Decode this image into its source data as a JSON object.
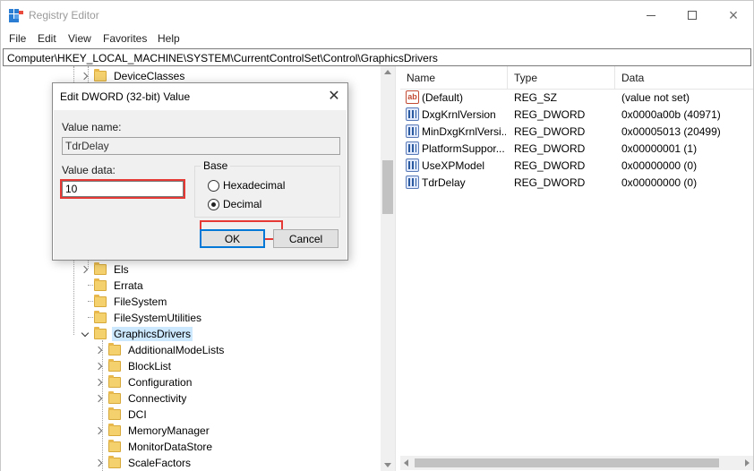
{
  "window": {
    "title": "Registry Editor",
    "controls": {
      "minimize": "minimize",
      "maximize": "maximize",
      "close": "×"
    }
  },
  "menubar": [
    "File",
    "Edit",
    "View",
    "Favorites",
    "Help"
  ],
  "address": "Computer\\HKEY_LOCAL_MACHINE\\SYSTEM\\CurrentControlSet\\Control\\GraphicsDrivers",
  "tree": {
    "top_item": "DeviceClasses",
    "items": [
      "Els",
      "Errata",
      "FileSystem",
      "FileSystemUtilities",
      "GraphicsDrivers"
    ],
    "children": [
      "AdditionalModeLists",
      "BlockList",
      "Configuration",
      "Connectivity",
      "DCI",
      "MemoryManager",
      "MonitorDataStore",
      "ScaleFactors"
    ]
  },
  "list": {
    "columns": {
      "name": "Name",
      "type": "Type",
      "data": "Data"
    },
    "rows": [
      {
        "name": "(Default)",
        "type": "REG_SZ",
        "data": "(value not set)",
        "icon": "string-value-icon"
      },
      {
        "name": "DxgKrnlVersion",
        "type": "REG_DWORD",
        "data": "0x0000a00b (40971)",
        "icon": "binary-value-icon"
      },
      {
        "name": "MinDxgKrnlVersi...",
        "type": "REG_DWORD",
        "data": "0x00005013 (20499)",
        "icon": "binary-value-icon"
      },
      {
        "name": "PlatformSuppor...",
        "type": "REG_DWORD",
        "data": "0x00000001 (1)",
        "icon": "binary-value-icon"
      },
      {
        "name": "UseXPModel",
        "type": "REG_DWORD",
        "data": "0x00000000 (0)",
        "icon": "binary-value-icon"
      },
      {
        "name": "TdrDelay",
        "type": "REG_DWORD",
        "data": "0x00000000 (0)",
        "icon": "binary-value-icon"
      }
    ]
  },
  "dialog": {
    "title": "Edit DWORD (32-bit) Value",
    "close": "✕",
    "value_name_label": "Value name:",
    "value_name": "TdrDelay",
    "value_data_label": "Value data:",
    "value_data": "10",
    "base_label": "Base",
    "hex_label": "Hexadecimal",
    "dec_label": "Decimal",
    "selected_base": "Decimal",
    "ok_label": "OK",
    "cancel_label": "Cancel"
  },
  "colors": {
    "highlight": "#e53935",
    "selection": "#cce8ff",
    "folder": "#f5d16e",
    "default_button_border": "#0078d7"
  }
}
